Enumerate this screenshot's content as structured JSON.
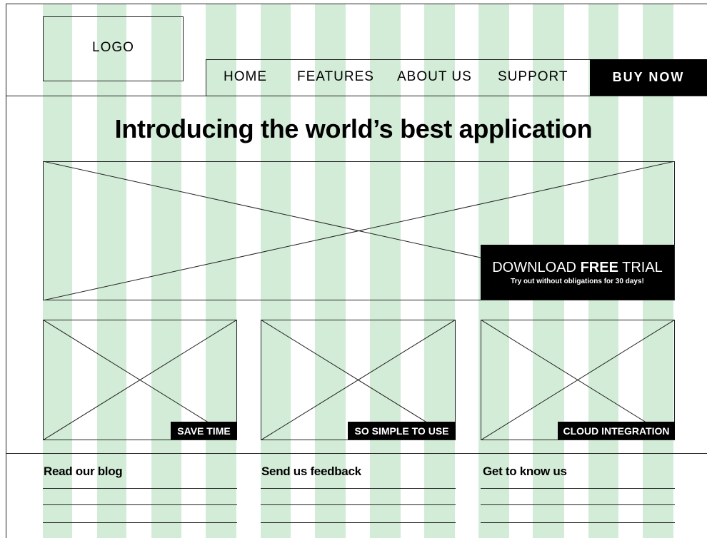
{
  "header": {
    "logo": "LOGO",
    "nav": [
      "HOME",
      "FEATURES",
      "ABOUT US",
      "SUPPORT"
    ],
    "cta": "BUY NOW"
  },
  "hero": {
    "headline": "Introducing the world’s best application",
    "download": {
      "pre": "DOWNLOAD ",
      "strong": "FREE",
      "post": " TRIAL",
      "subtitle": "Try out without obligations for 30 days!"
    }
  },
  "features": [
    "SAVE TIME",
    "SO SIMPLE TO USE",
    "CLOUD INTEGRATION"
  ],
  "footer": {
    "sections": [
      "Read our blog",
      "Send us feedback",
      "Get to know us"
    ]
  },
  "colors": {
    "grid_column": "#d3ecd8",
    "ink": "#000000",
    "background": "#ffffff"
  }
}
